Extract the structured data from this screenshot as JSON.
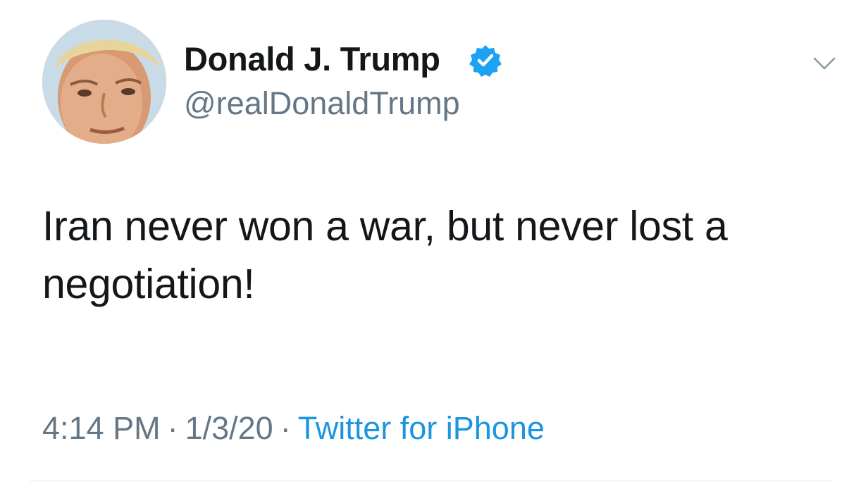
{
  "tweet": {
    "author": {
      "display_name": "Donald J. Trump",
      "handle": "@realDonaldTrump",
      "verified": true
    },
    "text": "Iran never won a war, but never lost a negotiation!",
    "time": "4:14 PM",
    "separator": "·",
    "date": "1/3/20",
    "source": "Twitter for iPhone"
  },
  "colors": {
    "text": "#14171a",
    "secondary": "#657786",
    "link": "#1b95e0",
    "verified": "#1da1f2",
    "divider": "#e1e8ed"
  },
  "icons": {
    "verified": "verified-badge-icon",
    "menu": "chevron-down-icon"
  }
}
